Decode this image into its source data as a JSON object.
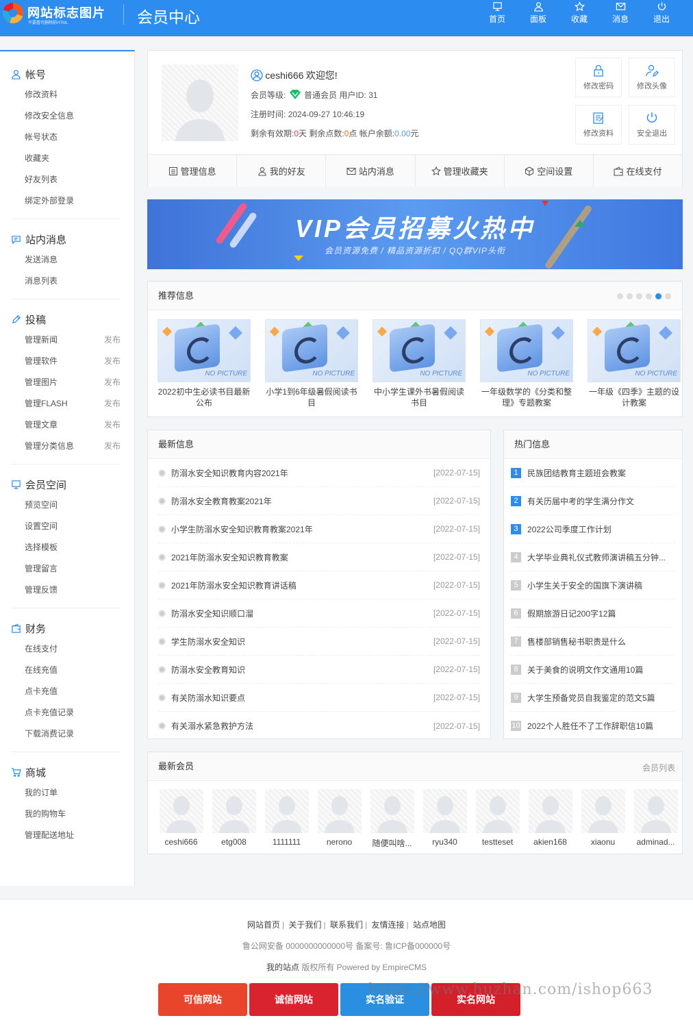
{
  "header": {
    "logo_title": "网站标志图片",
    "logo_sub": "不要看可删除前HTML",
    "page_title": "会员中心",
    "nav": [
      {
        "label": "首页",
        "icon": "monitor-icon"
      },
      {
        "label": "面板",
        "icon": "user-icon"
      },
      {
        "label": "收藏",
        "icon": "star-icon"
      },
      {
        "label": "消息",
        "icon": "mail-icon"
      },
      {
        "label": "退出",
        "icon": "power-icon"
      }
    ]
  },
  "sidebar": {
    "groups": [
      {
        "title": "帐号",
        "icon": "user-icon",
        "items": [
          {
            "label": "修改资料"
          },
          {
            "label": "修改安全信息"
          },
          {
            "label": "帐号状态"
          },
          {
            "label": "收藏夹"
          },
          {
            "label": "好友列表"
          },
          {
            "label": "绑定外部登录"
          }
        ]
      },
      {
        "title": "站内消息",
        "icon": "chat-icon",
        "items": [
          {
            "label": "发送消息"
          },
          {
            "label": "消息列表"
          }
        ]
      },
      {
        "title": "投稿",
        "icon": "pen-icon",
        "items": [
          {
            "label": "管理新闻",
            "action": "发布"
          },
          {
            "label": "管理软件",
            "action": "发布"
          },
          {
            "label": "管理图片",
            "action": "发布"
          },
          {
            "label": "管理FLASH",
            "action": "发布"
          },
          {
            "label": "管理文章",
            "action": "发布"
          },
          {
            "label": "管理分类信息",
            "action": "发布"
          }
        ]
      },
      {
        "title": "会员空间",
        "icon": "monitor-icon",
        "items": [
          {
            "label": "预览空间"
          },
          {
            "label": "设置空间"
          },
          {
            "label": "选择模板"
          },
          {
            "label": "管理留言"
          },
          {
            "label": "管理反馈"
          }
        ]
      },
      {
        "title": "财务",
        "icon": "wallet-icon",
        "items": [
          {
            "label": "在线支付"
          },
          {
            "label": "在线充值"
          },
          {
            "label": "点卡充值"
          },
          {
            "label": "点卡充值记录"
          },
          {
            "label": "下载消费记录"
          }
        ]
      },
      {
        "title": "商城",
        "icon": "cart-icon",
        "items": [
          {
            "label": "我的订单"
          },
          {
            "label": "我的购物车"
          },
          {
            "label": "管理配送地址"
          }
        ]
      }
    ]
  },
  "user": {
    "name": "ceshi666",
    "welcome": "欢迎您!",
    "level_label": "会员等级:",
    "level": "普通会员",
    "uid_label": "用户ID:",
    "uid": "31",
    "reg_label": "注册时间:",
    "reg_time": "2024-09-27 10:46:19",
    "validity_label": "剩余有效期:",
    "validity": "0",
    "validity_unit": "天",
    "points_label": "剩余点数:",
    "points": "0",
    "points_unit": "点",
    "balance_label": "帐户余额:",
    "balance": "0.00",
    "balance_unit": "元"
  },
  "quick_buttons": [
    {
      "label": "修改密码",
      "icon": "lock-icon"
    },
    {
      "label": "修改头像",
      "icon": "user-edit-icon"
    },
    {
      "label": "修改资料",
      "icon": "edit-icon"
    },
    {
      "label": "安全退出",
      "icon": "power-icon"
    }
  ],
  "tabs": [
    {
      "label": "管理信息",
      "icon": "list-icon"
    },
    {
      "label": "我的好友",
      "icon": "user-icon"
    },
    {
      "label": "站内消息",
      "icon": "mail-icon"
    },
    {
      "label": "管理收藏夹",
      "icon": "star-icon"
    },
    {
      "label": "空间设置",
      "icon": "cube-icon"
    },
    {
      "label": "在线支付",
      "icon": "wallet-icon"
    }
  ],
  "banner": {
    "title": "VIP会员招募火热中",
    "subtitle": "会员资源免费  /  精品资源折扣  /  QQ群VIP头衔"
  },
  "recommend": {
    "title": "推荐信息",
    "active_dot": 5,
    "dot_count": 6,
    "nopic_text": "NO PICTURE",
    "items": [
      {
        "title": "2022初中生必读书目最新公布"
      },
      {
        "title": "小学1到6年级暑假阅读书目"
      },
      {
        "title": "中小学生课外书暑假阅读书目"
      },
      {
        "title": "一年级数学的《分类和整理》专题教案"
      },
      {
        "title": "一年级《四季》主题的设计教案"
      }
    ]
  },
  "latest": {
    "title": "最新信息",
    "items": [
      {
        "title": "防溺水安全知识教育内容2021年",
        "date": "[2022-07-15]"
      },
      {
        "title": "防溺水安全教育教案2021年",
        "date": "[2022-07-15]"
      },
      {
        "title": "小学生防溺水安全知识教育教案2021年",
        "date": "[2022-07-15]"
      },
      {
        "title": "2021年防溺水安全知识教育教案",
        "date": "[2022-07-15]"
      },
      {
        "title": "2021年防溺水安全知识教育讲话稿",
        "date": "[2022-07-15]"
      },
      {
        "title": "防溺水安全知识顺口溜",
        "date": "[2022-07-15]"
      },
      {
        "title": "学生防溺水安全知识",
        "date": "[2022-07-15]"
      },
      {
        "title": "防溺水安全教育知识",
        "date": "[2022-07-15]"
      },
      {
        "title": "有关防溺水知识要点",
        "date": "[2022-07-15]"
      },
      {
        "title": "有关溺水紧急救护方法",
        "date": "[2022-07-15]"
      }
    ]
  },
  "hot": {
    "title": "热门信息",
    "items": [
      {
        "num": "1",
        "title": "民族团结教育主题班会教案"
      },
      {
        "num": "2",
        "title": "有关历届中考的学生满分作文"
      },
      {
        "num": "3",
        "title": "2022公司季度工作计划"
      },
      {
        "num": "4",
        "title": "大学毕业典礼仪式教师演讲稿五分钟..."
      },
      {
        "num": "5",
        "title": "小学生关于安全的国旗下演讲稿"
      },
      {
        "num": "6",
        "title": "假期旅游日记200字12篇"
      },
      {
        "num": "7",
        "title": "售楼部销售秘书职责是什么"
      },
      {
        "num": "8",
        "title": "关于美食的说明文作文通用10篇"
      },
      {
        "num": "9",
        "title": "大学生预备党员自我鉴定的范文5篇"
      },
      {
        "num": "10",
        "title": "2022个人胜任不了工作辞职信10篇"
      }
    ]
  },
  "members": {
    "title": "最新会员",
    "more": "会员列表",
    "items": [
      {
        "name": "ceshi666"
      },
      {
        "name": "etg008"
      },
      {
        "name": "1111111"
      },
      {
        "name": "nerono"
      },
      {
        "name": "随便叫啥..."
      },
      {
        "name": "ryu340"
      },
      {
        "name": "testteset"
      },
      {
        "name": "akien168"
      },
      {
        "name": "xiaonu"
      },
      {
        "name": "adminad..."
      }
    ]
  },
  "footer": {
    "links": [
      "网站首页",
      "关于我们",
      "联系我们",
      "友情连接",
      "站点地图"
    ],
    "police": "鲁公网安备 0000000000000号 备案号:  鲁ICP备000000号",
    "site_name": "我的站点",
    "copyright": "版权所有 Powered by EmpireCMS",
    "badges": [
      {
        "label": "可信网站",
        "color": "#e8452c"
      },
      {
        "label": "诚信网站",
        "color": "#d9232e"
      },
      {
        "label": "实名验证",
        "color": "#2a8fe0"
      },
      {
        "label": "实名网站",
        "color": "#d3202a"
      }
    ],
    "watermark": "https://www.huzhan.com/ishop663"
  },
  "colors": {
    "accent": "#2d8cf0",
    "red": "#e4393c"
  }
}
